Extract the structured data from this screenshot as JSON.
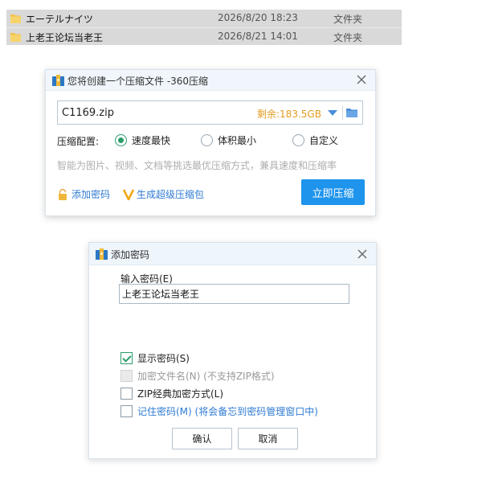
{
  "files": [
    {
      "name": "エーテルナイツ",
      "date": "2026/8/20 18:23",
      "type": "文件夹"
    },
    {
      "name": "上老王论坛当老王",
      "date": "2026/8/21 14:01",
      "type": "文件夹"
    }
  ],
  "compress_dialog": {
    "title": "您将创建一个压缩文件 -360压缩",
    "filename": "C1169.zip",
    "remaining": "剩余:183.5GB",
    "config_label": "压缩配置:",
    "options": [
      "速度最快",
      "体积最小",
      "自定义"
    ],
    "selected_option": "速度最快",
    "hint": "智能为图片、视频、文档等挑选最优压缩方式，兼具速度和压缩率",
    "add_password_link": "添加密码",
    "super_pack_link": "生成超级压缩包",
    "compress_button": "立即压缩"
  },
  "password_dialog": {
    "title": "添加密码",
    "input_label": "输入密码(E)",
    "password_value": "上老王论坛当老王",
    "show_password": "显示密码(S)",
    "encrypt_filenames": "加密文件名(N) (不支持ZIP格式)",
    "zip_classic": "ZIP经典加密方式(L)",
    "remember_password": "记住密码(M) (将会备忘到密码管理窗口中)",
    "ok_button": "确认",
    "cancel_button": "取消"
  },
  "colors": {
    "accent": "#1e94ec",
    "check_green": "#2a9d6a",
    "link_blue": "#2f7bd2",
    "remaining_orange": "#e39b1e",
    "row_selected": "#d9d9d9"
  }
}
